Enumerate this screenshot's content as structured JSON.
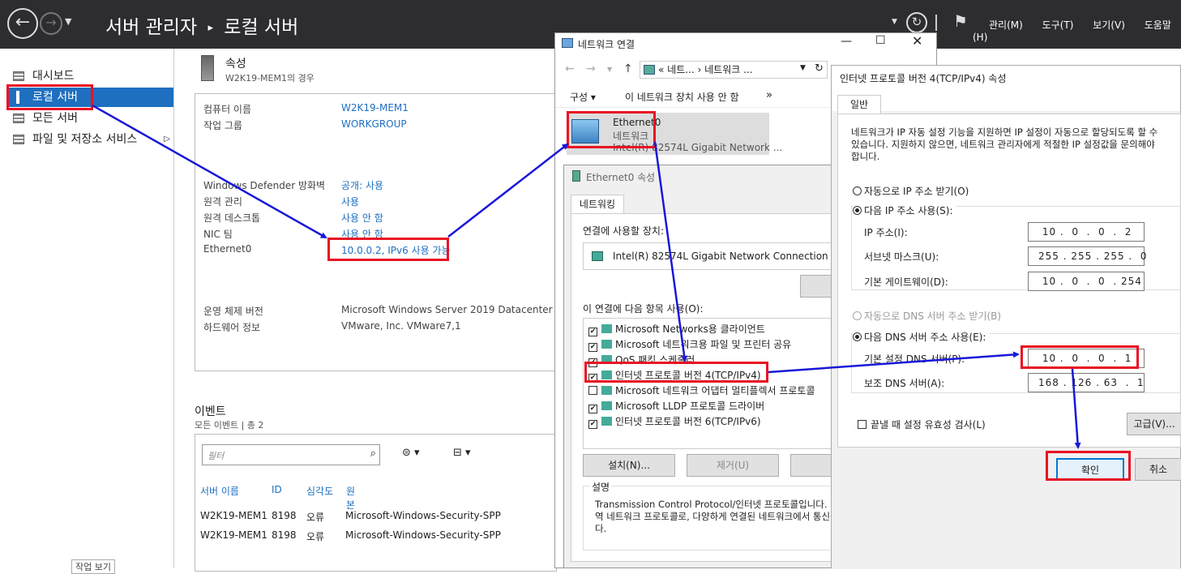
{
  "server_manager": {
    "title_part1": "서버 관리자",
    "title_sep": "▸",
    "title_part2": "로컬 서버",
    "menus": [
      "관리(M)",
      "도구(T)",
      "보기(V)",
      "도움말(H)"
    ],
    "nav": [
      {
        "label": "대시보드"
      },
      {
        "label": "로컬 서버"
      },
      {
        "label": "모든 서버"
      },
      {
        "label": "파일 및 저장소 서비스"
      }
    ],
    "props_heading": "속성",
    "props_subheading": "W2K19-MEM1의 경우",
    "props": {
      "computer_name_label": "컴퓨터 이름",
      "computer_name": "W2K19-MEM1",
      "workgroup_label": "작업 그룹",
      "workgroup": "WORKGROUP",
      "defender_label": "Windows Defender 방화벽",
      "defender": "공개: 사용",
      "remote_mgmt_label": "원격 관리",
      "remote_mgmt": "사용",
      "remote_desktop_label": "원격 데스크톱",
      "remote_desktop": "사용 안 함",
      "nic_team_label": "NIC 팀",
      "nic_team": "사용 안 함",
      "ethernet_label": "Ethernet0",
      "ethernet": "10.0.0.2, IPv6 사용 가능",
      "os_label": "운영 체제 버전",
      "os": "Microsoft Windows Server 2019 Datacenter",
      "hw_label": "하드웨어 정보",
      "hw": "VMware, Inc. VMware7,1"
    },
    "events": {
      "heading": "이벤트",
      "subheading": "모든 이벤트 | 총 2",
      "filter_placeholder": "필터",
      "columns": [
        "서버 이름",
        "ID",
        "심각도",
        "원본"
      ],
      "rows": [
        [
          "W2K19-MEM1",
          "8198",
          "오류",
          "Microsoft-Windows-Security-SPP"
        ],
        [
          "W2K19-MEM1",
          "8198",
          "오류",
          "Microsoft-Windows-Security-SPP"
        ]
      ],
      "bottom_text": "작업 보기"
    }
  },
  "netconn": {
    "title": "네트워크 연결",
    "address": "« 네트... › 네트워크 ...",
    "toolbar_organize": "구성",
    "toolbar_disable": "이 네트워크 장치 사용 안 함",
    "toolbar_more": "»",
    "adapter_name": "Ethernet0",
    "adapter_status": "네트워크",
    "adapter_device": "Intel(R) 82574L Gigabit Network ..."
  },
  "ethprops": {
    "title": "Ethernet0 속성",
    "tab": "네트워킹",
    "connect_using_label": "연결에 사용할 장치:",
    "device": "Intel(R) 82574L Gigabit Network Connection",
    "configure_btn": "구",
    "items_label": "이 연결에 다음 항목 사용(O):",
    "items": [
      {
        "checked": true,
        "label": "Microsoft Networks용 클라이언트"
      },
      {
        "checked": true,
        "label": "Microsoft 네트워크용 파일 및 프린터 공유"
      },
      {
        "checked": true,
        "label": "QoS 패킷 스케줄러"
      },
      {
        "checked": true,
        "label": "인터넷 프로토콜 버전 4(TCP/IPv4)"
      },
      {
        "checked": false,
        "label": "Microsoft 네트워크 어댑터 멀티플렉서 프로토콜"
      },
      {
        "checked": true,
        "label": "Microsoft LLDP 프로토콜 드라이버"
      },
      {
        "checked": true,
        "label": "인터넷 프로토콜 버전 6(TCP/IPv6)"
      }
    ],
    "install_btn": "설치(N)...",
    "remove_btn": "제거(U)",
    "props_btn": "속",
    "desc_label": "설명",
    "desc_text": "Transmission Control Protocol/인터넷 프로토콜입니다. 기본적인 광역 네트워크 프로토콜로, 다양하게 연결된 네트워크에서 통신을 제공합니다."
  },
  "ipv4": {
    "title": "인터넷 프로토콜 버전 4(TCP/IPv4) 속성",
    "tab": "일반",
    "intro": "네트워크가 IP 자동 설정 기능을 지원하면 IP 설정이 자동으로 할당되도록 할 수 있습니다. 지원하지 않으면, 네트워크 관리자에게 적절한 IP 설정값을 문의해야 합니다.",
    "auto_ip": "자동으로 IP 주소 받기(O)",
    "manual_ip": "다음 IP 주소 사용(S):",
    "ip_label": "IP 주소(I):",
    "ip": " 10 .  0  .  0  .  2",
    "mask_label": "서브넷 마스크(U):",
    "mask": "255 . 255 . 255 .  0",
    "gw_label": "기본 게이트웨이(D):",
    "gw": " 10 .  0  .  0  . 254",
    "auto_dns": "자동으로 DNS 서버 주소 받기(B)",
    "manual_dns": "다음 DNS 서버 주소 사용(E):",
    "dns1_label": "기본 설정 DNS 서버(P):",
    "dns1": " 10 .  0  .  0  .  1",
    "dns2_label": "보조 DNS 서버(A):",
    "dns2": "168 . 126 . 63  .  1",
    "validate": "끝낼 때 설정 유효성 검사(L)",
    "advanced_btn": "고급(V)...",
    "ok_btn": "확인",
    "cancel_btn": "취소"
  },
  "colors": {
    "accent": "#1e6fc0",
    "highlight": "#e81123",
    "arrow": "#1818d8",
    "header": "#2d2d30"
  }
}
